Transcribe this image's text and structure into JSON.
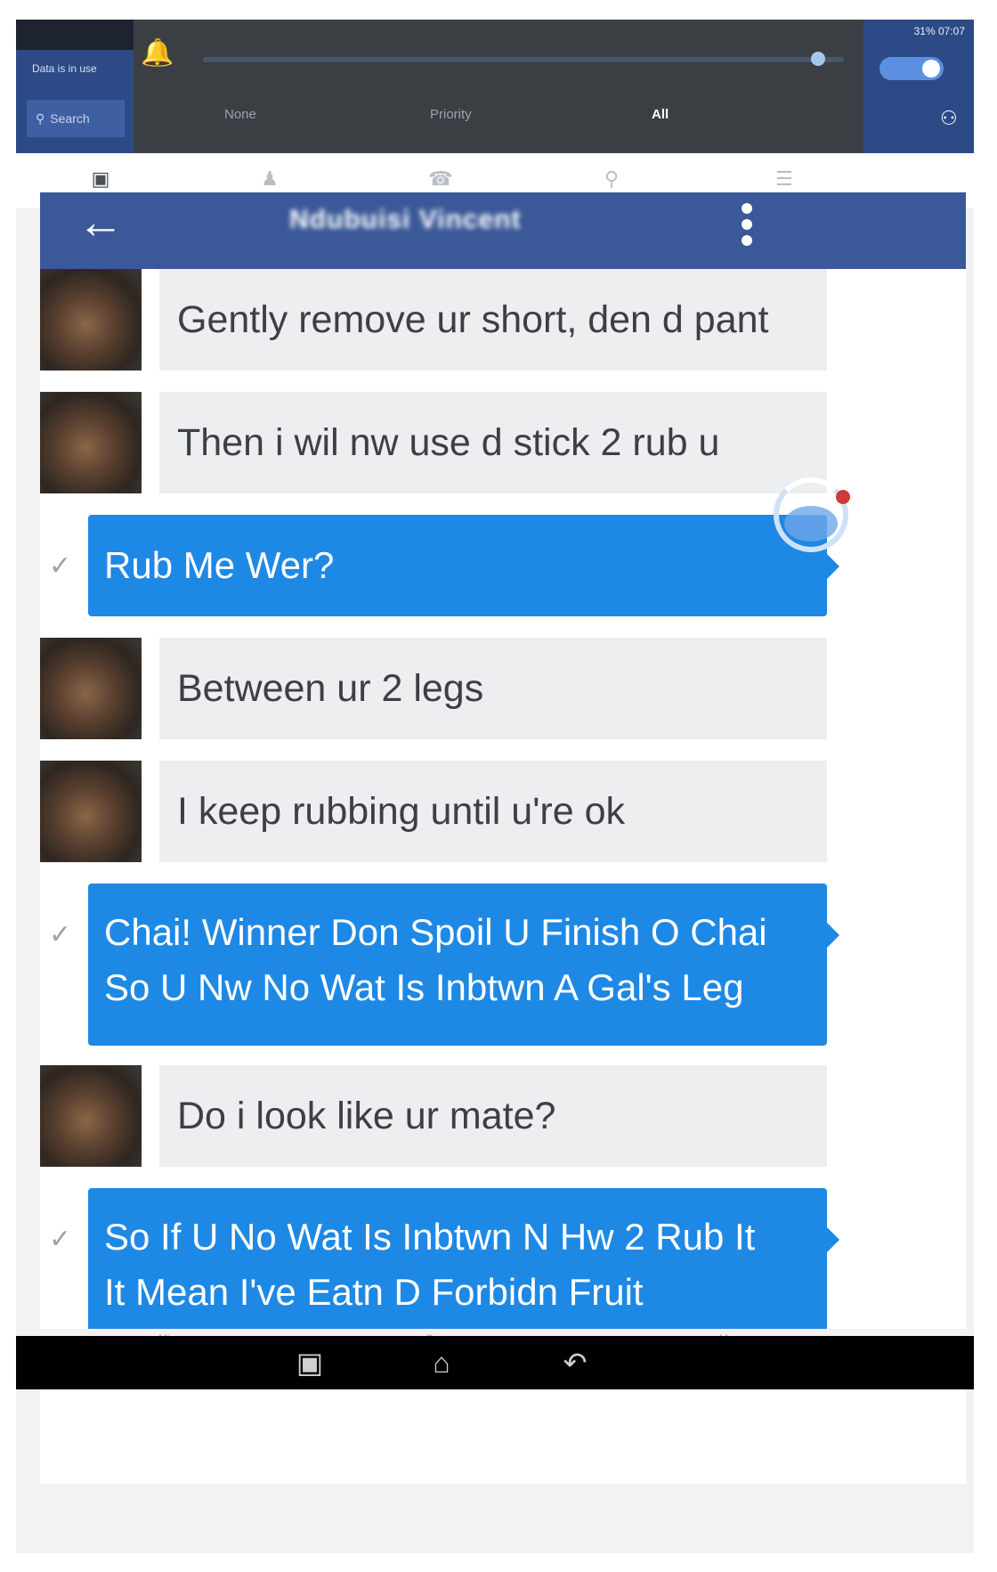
{
  "shade": {
    "data_label": "Data is in use",
    "search_label": "Search",
    "tabs": [
      "None",
      "Priority",
      "All"
    ],
    "active_tab": "All",
    "status_text": "31% 07:07",
    "brightness": 0.97
  },
  "toolbar": {
    "icons": [
      "calendar-icon",
      "contacts-icon",
      "phone-icon",
      "pin-icon",
      "list-icon"
    ]
  },
  "chat": {
    "contact_name": "Ndubuisi Vincent",
    "back_label": "←",
    "messages": [
      {
        "dir": "in",
        "text": "Gently remove ur short, den d pant"
      },
      {
        "dir": "in",
        "text": "Then i wil nw use d stick 2 rub u"
      },
      {
        "dir": "out",
        "lines": [
          "Rub Me Wer?"
        ]
      },
      {
        "dir": "in",
        "text": "Between ur 2 legs"
      },
      {
        "dir": "in",
        "text": "I keep rubbing until u're ok"
      },
      {
        "dir": "out",
        "lines": [
          "Chai! Winner Don Spoil U Finish O Chai",
          "So U Nw No Wat Is Inbtwn A Gal's Leg"
        ]
      },
      {
        "dir": "in",
        "text": "Do i look like ur mate?"
      },
      {
        "dir": "out",
        "lines": [
          "So If U No Wat Is Inbtwn N Hw 2 Rub It",
          "It Mean I've Eatn D Forbidn Fruit"
        ]
      }
    ]
  },
  "bottom_labels": [
    "Mic",
    "Camera",
    "More"
  ],
  "navbar": {
    "icons": [
      "recent-apps-icon",
      "home-icon",
      "back-icon"
    ]
  },
  "colors": {
    "header": "#3b5998",
    "outgoing": "#1e88e5",
    "incoming": "#eceef0"
  }
}
